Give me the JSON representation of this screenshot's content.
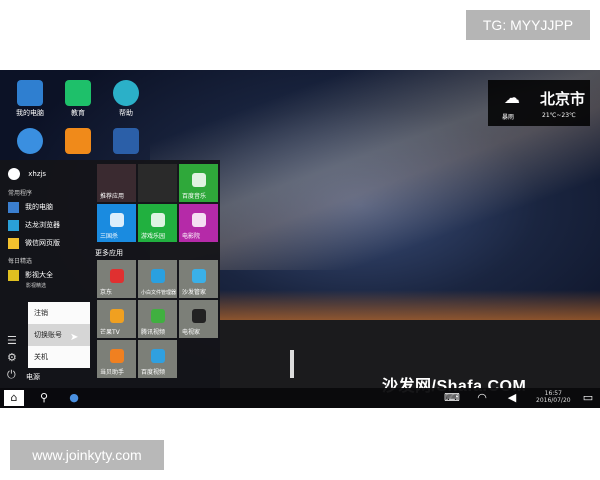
{
  "watermark_top": "TG: MYYJJPP",
  "watermark_bottom": "www.joinkyty.com",
  "weather": {
    "city": "北京市",
    "condition": "暴雨",
    "temp": "21℃~23℃",
    "icon": "rain-cloud-icon"
  },
  "desktop_icons": [
    {
      "label": "我的电脑",
      "color": "#2f7fd0",
      "icon": "computer-icon"
    },
    {
      "label": "教育",
      "color": "#1ec06a",
      "icon": "graduation-cap-icon"
    },
    {
      "label": "帮助",
      "color": "#2bb0c8",
      "icon": "help-icon"
    },
    {
      "label": "",
      "color": "#3a8fe0",
      "icon": "browser-e-icon"
    },
    {
      "label": "",
      "color": "#f08a1a",
      "icon": "store-icon"
    },
    {
      "label": "",
      "color": "#2b5fa8",
      "icon": "word-icon"
    }
  ],
  "start_menu": {
    "user": "xhzjs",
    "section_common": "常用程序",
    "apps": [
      {
        "label": "我的电脑",
        "color": "#3b7fcf",
        "icon": "computer-icon"
      },
      {
        "label": "达龙浏览器",
        "color": "#2aa0d8",
        "icon": "browser-icon"
      },
      {
        "label": "微信网页版",
        "color": "#f2c12e",
        "icon": "wechat-icon"
      }
    ],
    "section_daily": "每日精选",
    "featured": {
      "label": "影视大全",
      "sub": "影视精选",
      "icon": "film-icon"
    },
    "more_apps": "更多应用",
    "tiles_top": [
      {
        "label": "推荐应用",
        "color": "#3a2a30",
        "icon": "game-icon"
      },
      {
        "label": "",
        "color": "#2a2a2a",
        "icon": ""
      },
      {
        "label": "百度音乐",
        "color": "#2fa83a",
        "icon": "music-icon"
      },
      {
        "label": "三国杀",
        "color": "#1a8be0",
        "icon": "card-icon"
      },
      {
        "label": "游戏乐园",
        "color": "#21b03f",
        "icon": "gamepad-icon"
      },
      {
        "label": "电影院",
        "color": "#b52aa8",
        "icon": "cinema-icon"
      }
    ],
    "tiles_more": [
      {
        "label": "京东",
        "icon": "jd-icon"
      },
      {
        "label": "小白文件管理器",
        "icon": "folder-icon"
      },
      {
        "label": "沙发管家",
        "icon": "sofa-icon"
      },
      {
        "label": "芒果TV",
        "icon": "mango-icon"
      },
      {
        "label": "腾讯视频",
        "icon": "video-icon"
      },
      {
        "label": "电视家",
        "icon": "tv-icon"
      },
      {
        "label": "当贝助手",
        "icon": "helper-icon"
      },
      {
        "label": "百度视频",
        "icon": "baidu-video-icon"
      }
    ],
    "power_menu": [
      "注销",
      "切换账号",
      "关机"
    ],
    "power_label": "电源"
  },
  "taskbar": {
    "time": "16:57",
    "date": "2016/07/20"
  },
  "brand": "沙发网/Shafa.COM"
}
